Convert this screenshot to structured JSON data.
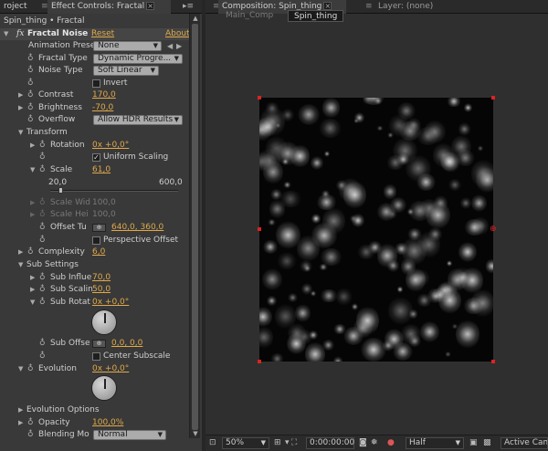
{
  "left_panel": {
    "tabs": [
      {
        "label": "roject"
      },
      {
        "label": "Effect Controls: Fractal"
      }
    ],
    "breadcrumb": "Spin_thing • Fractal",
    "effect": {
      "fx_icon": "fx",
      "name": "Fractal Noise",
      "reset": "Reset",
      "about": "About"
    },
    "props": {
      "animation_preset": {
        "label": "Animation Prese",
        "value": "None"
      },
      "fractal_type": {
        "label": "Fractal Type",
        "value": "Dynamic Progre..."
      },
      "noise_type": {
        "label": "Noise Type",
        "value": "Soft Linear"
      },
      "invert": {
        "label": "Invert",
        "checked": false
      },
      "contrast": {
        "label": "Contrast",
        "value": "170,0"
      },
      "brightness": {
        "label": "Brightness",
        "value": "-70,0"
      },
      "overflow": {
        "label": "Overflow",
        "value": "Allow HDR Results"
      },
      "transform": {
        "label": "Transform"
      },
      "rotation": {
        "label": "Rotation",
        "value": "0x +0,0°"
      },
      "uniform_scaling": {
        "label": "Uniform Scaling",
        "checked": true
      },
      "scale": {
        "label": "Scale",
        "value": "61,0",
        "min": "20,0",
        "max": "600,0",
        "slider_position": 0.07
      },
      "scale_width": {
        "label": "Scale Wid",
        "value": "100,0"
      },
      "scale_height": {
        "label": "Scale Hei",
        "value": "100,0"
      },
      "offset_turbulence": {
        "label": "Offset Tu",
        "value": "640,0, 360,0"
      },
      "perspective_offset": {
        "label": "Perspective Offset",
        "checked": false
      },
      "complexity": {
        "label": "Complexity",
        "value": "6,0"
      },
      "sub_settings": {
        "label": "Sub Settings"
      },
      "sub_influence": {
        "label": "Sub Influe",
        "value": "70,0"
      },
      "sub_scaling": {
        "label": "Sub Scalin",
        "value": "50,0"
      },
      "sub_rotation": {
        "label": "Sub Rotat",
        "value": "0x +0,0°"
      },
      "sub_offset": {
        "label": "Sub Offse",
        "value": "0,0, 0,0"
      },
      "center_subscale": {
        "label": "Center Subscale",
        "checked": false
      },
      "evolution": {
        "label": "Evolution",
        "value": "0x +0,0°"
      },
      "evolution_options": {
        "label": "Evolution Options"
      },
      "opacity": {
        "label": "Opacity",
        "value": "100,0%"
      },
      "blending_mode": {
        "label": "Blending Mo",
        "value": "Normal"
      }
    }
  },
  "right_panel": {
    "tabs": [
      {
        "label": "Composition: Spin_thing"
      },
      {
        "label": "Layer: (none)"
      }
    ],
    "comp_tabs": [
      {
        "label": "Main_Comp"
      },
      {
        "label": "Spin_thing"
      }
    ],
    "footer": {
      "zoom": "50%",
      "timecode": "0:00:00:00",
      "resolution": "Half",
      "camera": "Active Came"
    }
  },
  "colors": {
    "value_orange": "#e0a94a",
    "panel_bg": "#393939",
    "handle_red": "#dd2222"
  }
}
